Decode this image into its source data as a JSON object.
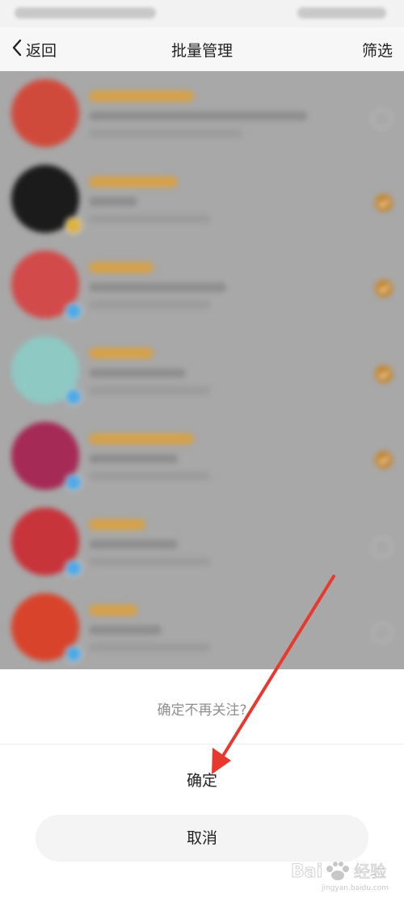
{
  "navbar": {
    "back_label": "返回",
    "title": "批量管理",
    "filter_label": "筛选"
  },
  "list": {
    "items": [
      {
        "avatar_color": "#d04a3c",
        "checked": false,
        "badge": "none"
      },
      {
        "avatar_color": "#1b1b1b",
        "checked": true,
        "badge": "gold"
      },
      {
        "avatar_color": "#d24a4a",
        "checked": true,
        "badge": "blue"
      },
      {
        "avatar_color": "#8ec9c4",
        "checked": true,
        "badge": "blue"
      },
      {
        "avatar_color": "#a52a55",
        "checked": true,
        "badge": "blue"
      },
      {
        "avatar_color": "#c7343a",
        "checked": false,
        "badge": "blue"
      },
      {
        "avatar_color": "#d8432b",
        "checked": false,
        "badge": "blue"
      }
    ]
  },
  "dialog": {
    "title": "确定不再关注?",
    "confirm_label": "确定",
    "cancel_label": "取消"
  },
  "colors": {
    "accent_check": "#c6862c",
    "annotation_arrow": "#e8392f"
  }
}
